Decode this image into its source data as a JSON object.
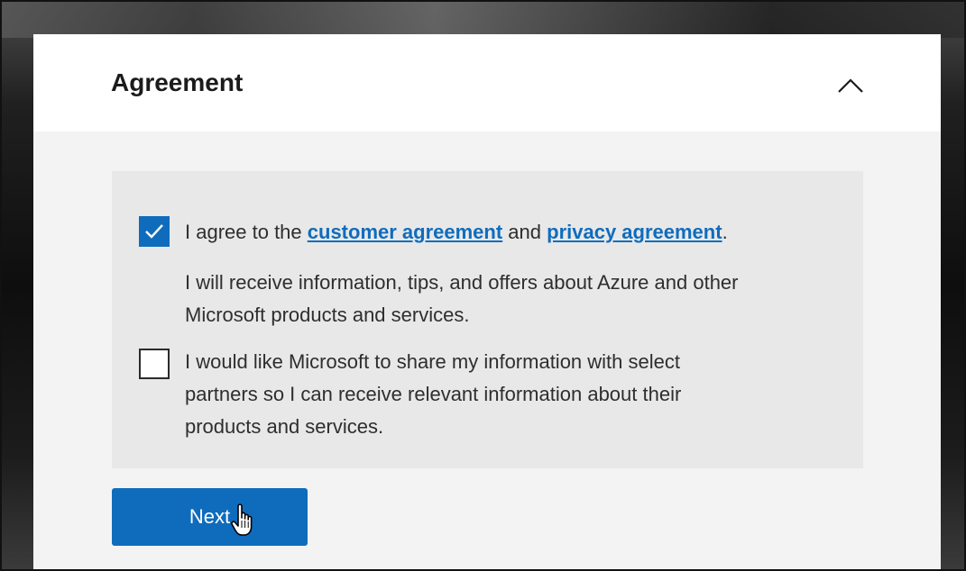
{
  "section": {
    "title": "Agreement",
    "collapse_icon": "chevron-up-icon"
  },
  "agreement": {
    "checkbox_checked": true,
    "prefix": "I agree to the ",
    "customer_link": "customer agreement",
    "middle": " and ",
    "privacy_link": "privacy agreement",
    "suffix": "."
  },
  "info": {
    "line1": "I will receive information, tips, and offers about Azure and other",
    "line2": "Microsoft products and services."
  },
  "partners": {
    "checkbox_checked": false,
    "line1": "I would like Microsoft to share my information with select",
    "line2": "partners so I can receive relevant information about their",
    "line3": "products and services."
  },
  "actions": {
    "next_label": "Next"
  },
  "colors": {
    "accent": "#0f6cbd",
    "panel": "#e8e8e8",
    "background": "#f3f3f3"
  }
}
